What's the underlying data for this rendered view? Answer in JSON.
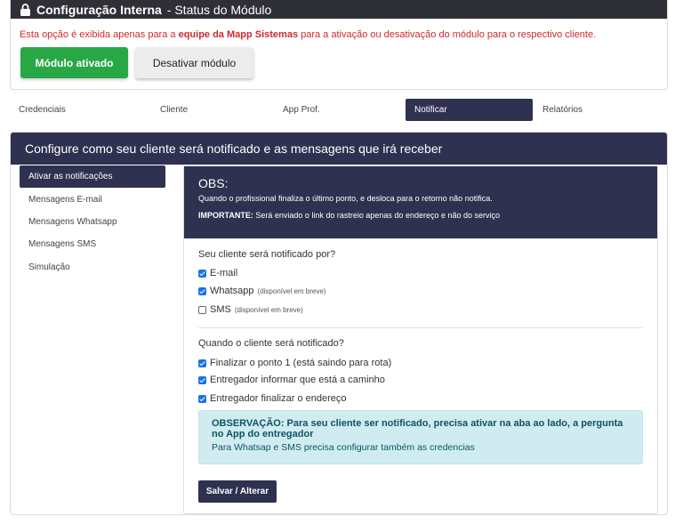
{
  "module": {
    "title_bold": "Configuração Interna",
    "title_rest": " - Status do Módulo",
    "warning_prefix": "Esta opção é exibida apenas para a ",
    "warning_bold": "equipe da Mapp Sistemas",
    "warning_suffix": " para a ativação ou desativação do módulo para o respectivo cliente.",
    "btn_active": "Módulo ativado",
    "btn_deactivate": "Desativar módulo"
  },
  "tabs": [
    {
      "label": "Credenciais"
    },
    {
      "label": "Cliente"
    },
    {
      "label": "App Prof."
    },
    {
      "label": "Notificar"
    },
    {
      "label": "Relatórios"
    }
  ],
  "panel": {
    "title": "Configure como seu cliente será notificado e as mensagens que irá receber"
  },
  "sidebar": [
    {
      "label": "Ativar as notificações"
    },
    {
      "label": "Mensagens E-mail"
    },
    {
      "label": "Mensagens Whatsapp"
    },
    {
      "label": "Mensagens SMS"
    },
    {
      "label": "Simulação"
    }
  ],
  "obs": {
    "title": "OBS:",
    "line1": "Quando o profissional finaliza o último ponto, e desloca para o retorno não notifica.",
    "line2_bold": "IMPORTANTE:",
    "line2_rest": " Será enviado o link do rastreio apenas do endereço e não do serviço"
  },
  "channels": {
    "question": "Seu cliente será notificado por?",
    "email": {
      "label": "E-mail",
      "checked": true
    },
    "whatsapp": {
      "label": "Whatsapp",
      "note": "(disponível em breve)",
      "checked": true
    },
    "sms": {
      "label": "SMS",
      "note": "(disponível em breve)",
      "checked": false
    }
  },
  "events": {
    "question": "Quando o cliente será notificado?",
    "items": [
      {
        "label": "Finalizar o ponto 1 (está saindo para rota)",
        "checked": true
      },
      {
        "label": "Entregador informar que está a caminho",
        "checked": true
      },
      {
        "label": "Entregador finalizar o endereço",
        "checked": true
      }
    ]
  },
  "alert": {
    "bold": "OBSERVAÇÃO: Para seu cliente ser notificado, precisa ativar na aba ao lado, a pergunta no App do entregador",
    "line2": "Para Whatsap e SMS precisa configurar também as credencias"
  },
  "save_label": "Salvar / Alterar"
}
